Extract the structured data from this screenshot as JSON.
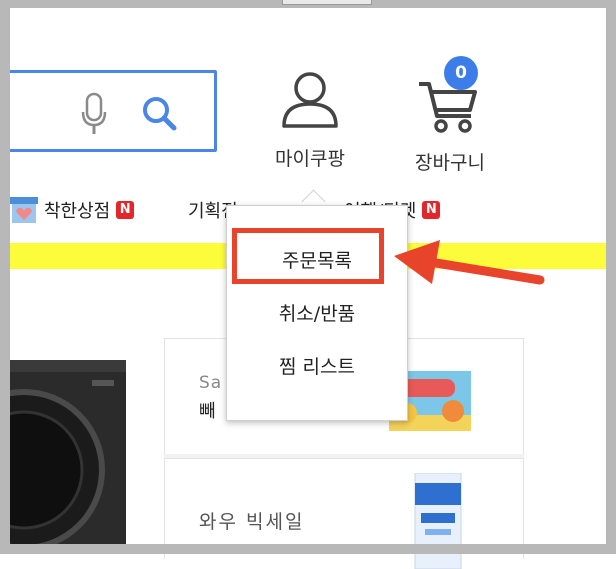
{
  "search": {
    "mic_icon": "microphone-icon",
    "search_icon": "search-icon"
  },
  "header": {
    "my_coupang_label": "마이쿠팡",
    "cart_label": "장바구니",
    "cart_count": "0"
  },
  "nav": {
    "items": [
      {
        "label": "착한상점",
        "badge": "N"
      },
      {
        "label": "기획전",
        "badge": ""
      },
      {
        "label": "여행/티켓",
        "badge": "N"
      }
    ]
  },
  "dropdown": {
    "items": [
      {
        "label": "주문목록"
      },
      {
        "label": "취소/반품"
      },
      {
        "label": "찜 리스트"
      }
    ],
    "highlighted": "주문목록"
  },
  "cards": [
    {
      "subtitle": "Sa",
      "title": "빼"
    },
    {
      "title": "와우 빅세일"
    }
  ],
  "colors": {
    "accent_blue": "#3d7dea",
    "search_border": "#4a86e8",
    "badge_red": "#e4262b",
    "highlight_red": "#e8442c",
    "banner_yellow": "#fcfc3a"
  }
}
